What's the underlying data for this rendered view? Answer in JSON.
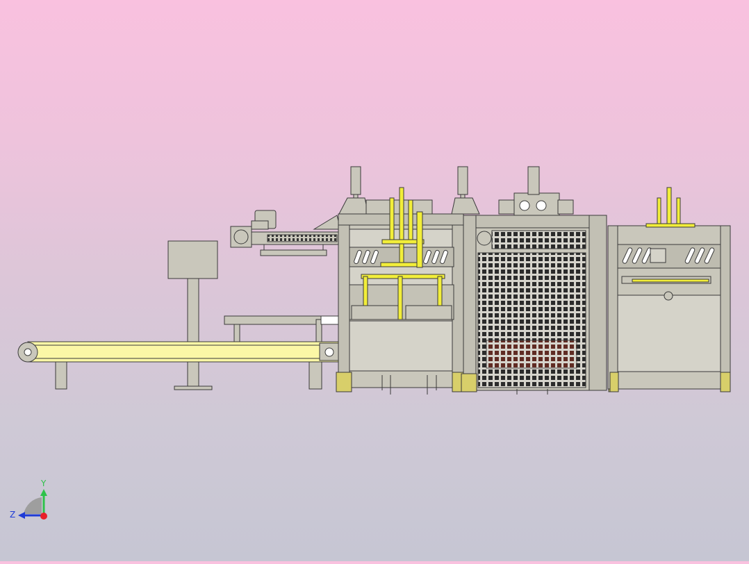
{
  "viewport": {
    "colors": {
      "background_top": "#f9c1df",
      "background_bottom": "#c6c6d3",
      "machine_body": "#c9c7bb",
      "machine_outline": "#3a3a3a",
      "accent_yellow": "#f2ee3a",
      "conveyor_belt": "#fbf7a6",
      "cage_red": "#b43a2a"
    }
  },
  "triad": {
    "y_label": "Y",
    "z_label": "Z",
    "icons": [
      "y-axis-arrow-icon",
      "z-axis-arrow-icon",
      "x-axis-origin-icon"
    ]
  }
}
